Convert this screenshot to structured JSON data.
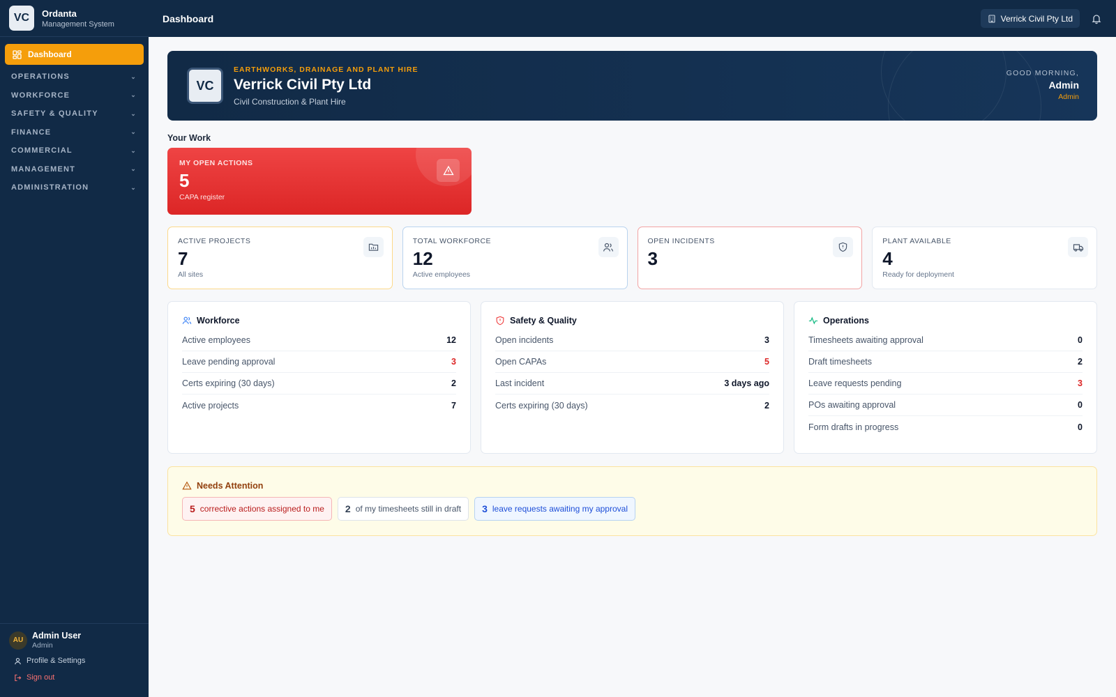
{
  "brand": {
    "logo": "VC",
    "name": "Ordanta",
    "subtitle": "Management System"
  },
  "sidebar": {
    "active": {
      "label": "Dashboard",
      "icon": "dashboard-icon"
    },
    "groups": [
      {
        "label": "OPERATIONS"
      },
      {
        "label": "WORKFORCE"
      },
      {
        "label": "SAFETY & QUALITY"
      },
      {
        "label": "FINANCE"
      },
      {
        "label": "COMMERCIAL"
      },
      {
        "label": "MANAGEMENT"
      },
      {
        "label": "ADMINISTRATION"
      }
    ],
    "user": {
      "initials": "AU",
      "name": "Admin User",
      "role": "Admin"
    },
    "profile_label": "Profile & Settings",
    "signout_label": "Sign out"
  },
  "topbar": {
    "title": "Dashboard",
    "org": "Verrick Civil Pty Ltd"
  },
  "hero": {
    "logo": "VC",
    "kicker": "EARTHWORKS, DRAINAGE AND PLANT HIRE",
    "title": "Verrick Civil Pty Ltd",
    "subtitle": "Civil Construction & Plant Hire",
    "greeting": "GOOD MORNING,",
    "user": "Admin",
    "role": "Admin"
  },
  "your_work": {
    "title": "Your Work",
    "card": {
      "label": "MY OPEN ACTIONS",
      "value": "5",
      "sub": "CAPA register"
    }
  },
  "stats": [
    {
      "label": "ACTIVE PROJECTS",
      "value": "7",
      "sub": "All sites",
      "icon": "folder-icon"
    },
    {
      "label": "TOTAL WORKFORCE",
      "value": "12",
      "sub": "Active employees",
      "icon": "users-icon"
    },
    {
      "label": "OPEN INCIDENTS",
      "value": "3",
      "sub": "",
      "icon": "shield-icon"
    },
    {
      "label": "PLANT AVAILABLE",
      "value": "4",
      "sub": "Ready for deployment",
      "icon": "truck-icon"
    }
  ],
  "panels": {
    "workforce": {
      "title": "Workforce",
      "rows": [
        {
          "label": "Active employees",
          "value": "12"
        },
        {
          "label": "Leave pending approval",
          "value": "3"
        },
        {
          "label": "Certs expiring (30 days)",
          "value": "2"
        },
        {
          "label": "Active projects",
          "value": "7"
        }
      ]
    },
    "safety": {
      "title": "Safety & Quality",
      "rows": [
        {
          "label": "Open incidents",
          "value": "3"
        },
        {
          "label": "Open CAPAs",
          "value": "5"
        },
        {
          "label": "Last incident",
          "value": "3 days ago"
        },
        {
          "label": "Certs expiring (30 days)",
          "value": "2"
        }
      ]
    },
    "operations": {
      "title": "Operations",
      "rows": [
        {
          "label": "Timesheets awaiting approval",
          "value": "0"
        },
        {
          "label": "Draft timesheets",
          "value": "2"
        },
        {
          "label": "Leave requests pending",
          "value": "3"
        },
        {
          "label": "POs awaiting approval",
          "value": "0"
        },
        {
          "label": "Form drafts in progress",
          "value": "0"
        }
      ]
    }
  },
  "attention": {
    "title": "Needs Attention",
    "items": [
      {
        "count": "5",
        "text": "corrective actions assigned to me"
      },
      {
        "count": "2",
        "text": "of my timesheets still in draft"
      },
      {
        "count": "3",
        "text": "leave requests awaiting my approval"
      }
    ]
  },
  "colors": {
    "navy": "#112a46",
    "accent": "#f59e0b",
    "danger": "#dc2626",
    "info": "#1d4ed8"
  }
}
